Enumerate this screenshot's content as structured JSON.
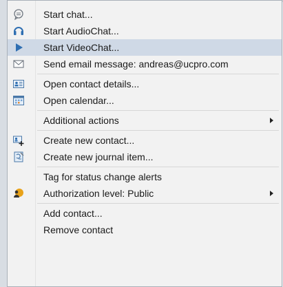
{
  "menu": {
    "items": {
      "start_chat": "Start chat...",
      "start_audiochat": "Start AudioChat...",
      "start_videochat": "Start VideoChat...",
      "send_email": "Send email message: andreas@ucpro.com",
      "open_contact_details": "Open contact details...",
      "open_calendar": "Open calendar...",
      "additional_actions": "Additional actions",
      "create_new_contact": "Create new contact...",
      "create_new_journal_item": "Create new journal item...",
      "tag_for_status_alerts": "Tag for status change alerts",
      "authorization_level": "Authorization level: Public",
      "add_contact": "Add contact...",
      "remove_contact": "Remove contact"
    },
    "icons": {
      "start_chat": "chat-bubble-icon",
      "start_audiochat": "headset-icon",
      "start_videochat": "play-icon",
      "send_email": "envelope-icon",
      "open_contact_details": "contact-card-icon",
      "open_calendar": "calendar-icon",
      "create_new_contact": "add-contact-icon",
      "create_new_journal_item": "journal-icon",
      "authorization_level": "authorization-icon"
    },
    "highlighted_item": "start_videochat",
    "colors": {
      "highlight": "#cfd9e6",
      "background": "#f2f2f2",
      "accent": "#2f6fb2"
    }
  }
}
